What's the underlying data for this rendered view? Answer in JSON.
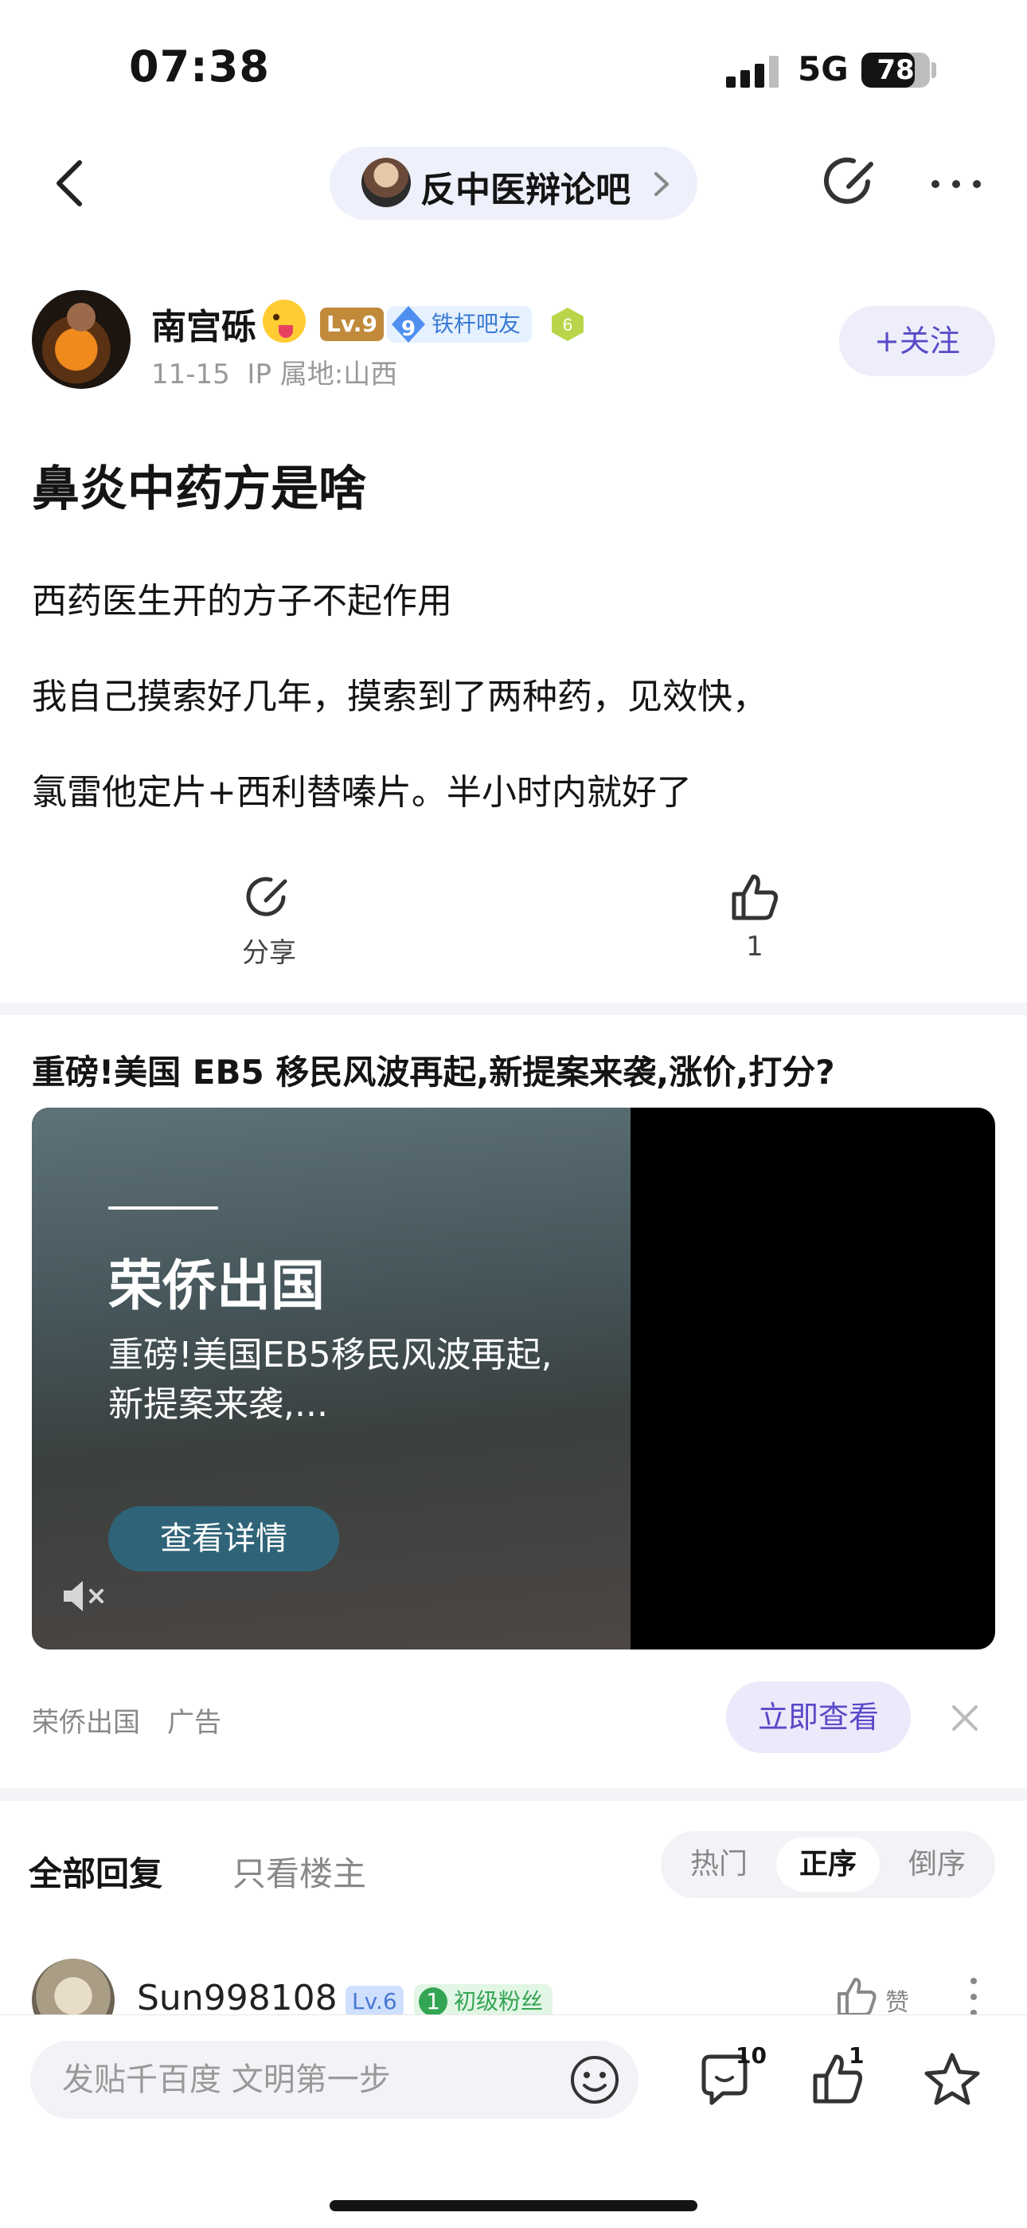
{
  "status_bar": {
    "time": "07:38",
    "network": "5G",
    "battery_level": "78",
    "battery_fraction": 0.78
  },
  "nav": {
    "forum_name": "反中医辩论吧",
    "icons": [
      "back-arrow-icon",
      "chevron-right-icon",
      "share-icon",
      "more-icon"
    ]
  },
  "author": {
    "name": "南宫砾",
    "level": "Lv.9",
    "fan_level": "9",
    "fan_title": "铁杆吧友",
    "hex_badge": "6",
    "date": "11-15",
    "ip_label": "IP 属地:山西",
    "follow_label": "+关注"
  },
  "post": {
    "title": "鼻炎中药方是啥",
    "body": [
      "西药医生开的方子不起作用",
      "我自己摸索好几年，摸索到了两种药，见效快，",
      "氯雷他定片+西利替嗪片。半小时内就好了"
    ],
    "share_label": "分享",
    "like_count": "1"
  },
  "ad": {
    "headline": "重磅!美国 EB5 移民风波再起,新提案来袭,涨价,打分?",
    "brand": "荣侨出国",
    "description": "重磅!美国EB5移民风波再起,新提案来袭,...",
    "cta": "查看详情",
    "sponsor": "荣侨出国",
    "tag": "广告",
    "open_label": "立即查看"
  },
  "replies": {
    "tab_all": "全部回复",
    "tab_op_only": "只看楼主",
    "sort_options": [
      "热门",
      "正序",
      "倒序"
    ],
    "active_sort": "正序",
    "first_reply": {
      "username": "Sun998108",
      "level": "Lv.6",
      "fan_level": "1",
      "fan_title": "初级粉丝",
      "like_label": "赞"
    }
  },
  "bottom_bar": {
    "placeholder": "发贴千百度 文明第一步",
    "comment_count": "10",
    "like_count": "1"
  },
  "colors": {
    "accent": "#5b4ac8",
    "pill_bg": "#eef0fb",
    "ad_cta_bg": "#2f6478"
  }
}
